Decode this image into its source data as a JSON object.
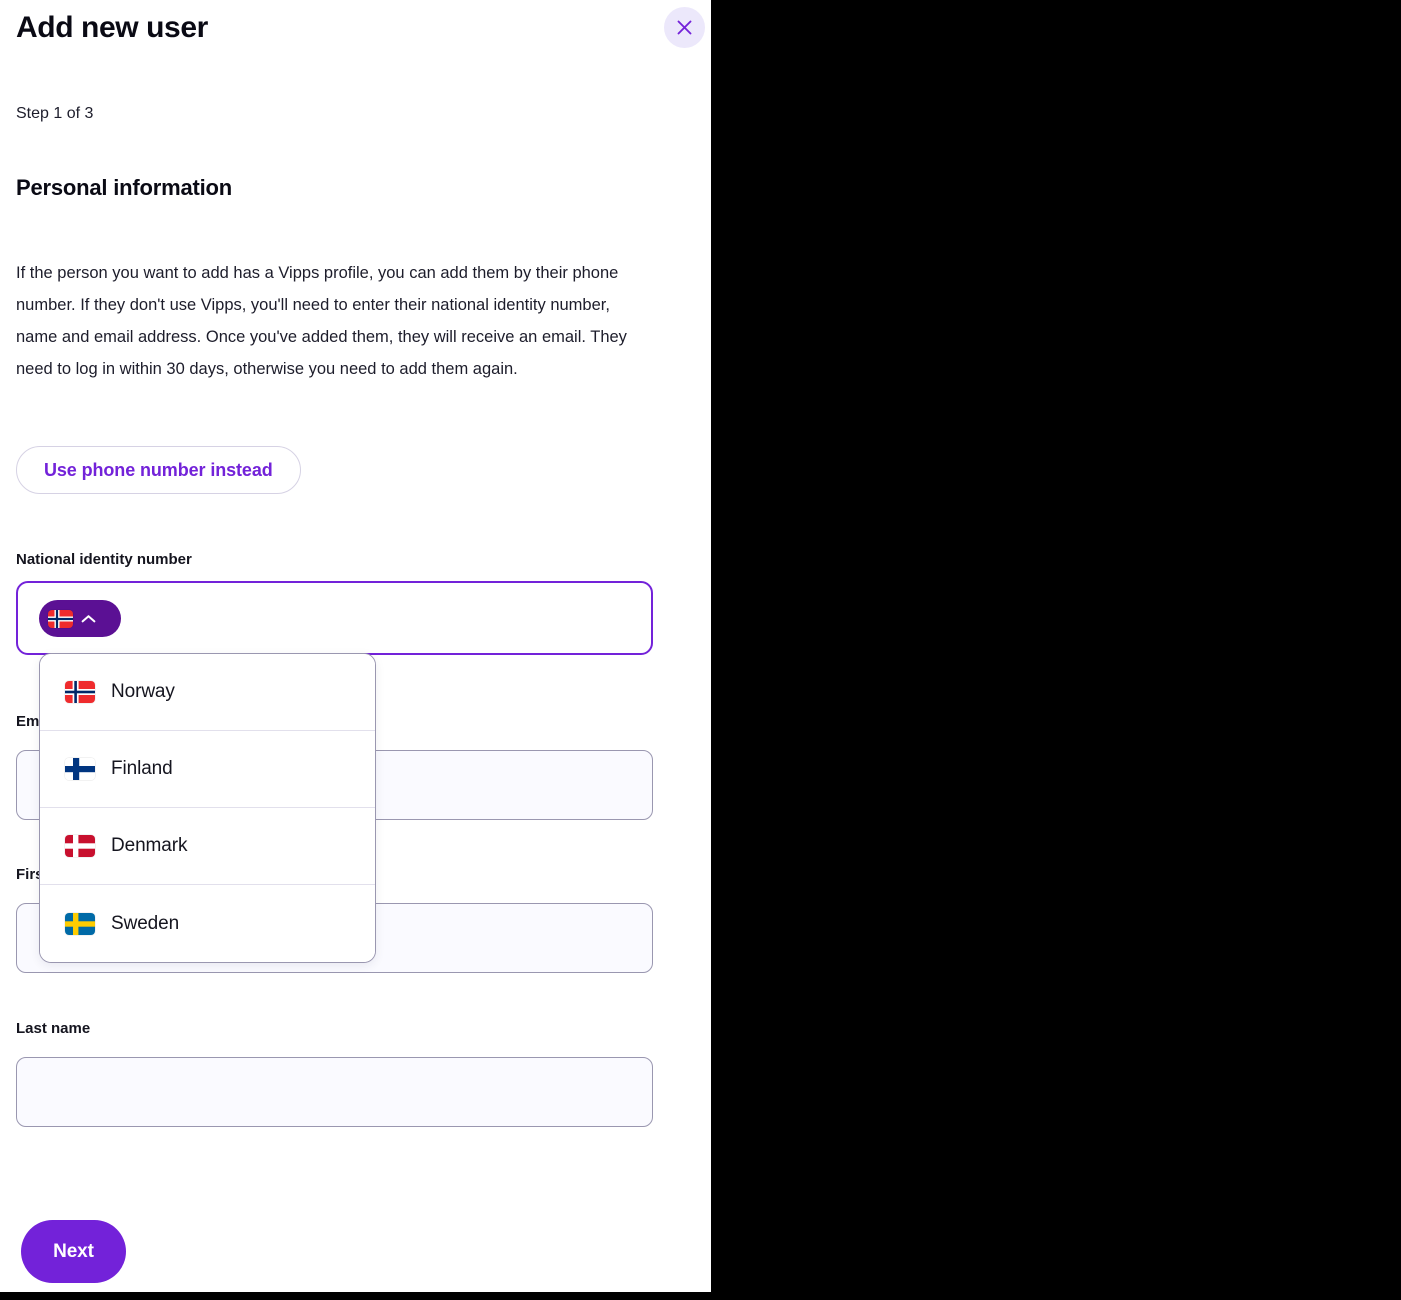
{
  "modal": {
    "title": "Add new user",
    "close_label": "×",
    "step": "Step 1 of 3",
    "section_title": "Personal information",
    "intro": "If the person you want to add has a Vipps profile, you can add them by their phone number. If they don't use Vipps, you'll need to enter their national identity number, name and email address. Once you've added them, they will receive an email. They need to log in within 30 days, otherwise you need to add them again.",
    "secondary_button": "Use phone number instead",
    "primary_button": "Next"
  },
  "form": {
    "national_identity": {
      "label": "National identity number",
      "value": "",
      "placeholder": ""
    },
    "email": {
      "label": "Email",
      "value": "",
      "placeholder": ""
    },
    "first_name": {
      "label": "First name",
      "value": "",
      "placeholder": ""
    },
    "last_name": {
      "label": "Last name",
      "value": "",
      "placeholder": ""
    }
  },
  "country_select": {
    "selected": "Norway",
    "selected_flag": "norway-flag-icon",
    "expanded": true,
    "chevron": "chevron-up-icon",
    "options": [
      {
        "label": "Norway",
        "flag": "norway-flag-icon"
      },
      {
        "label": "Finland",
        "flag": "finland-flag-icon"
      },
      {
        "label": "Denmark",
        "flag": "denmark-flag-icon"
      },
      {
        "label": "Sweden",
        "flag": "sweden-flag-icon"
      }
    ]
  },
  "colors": {
    "accent": "#7322d9",
    "accent_dark": "#5b1094",
    "close_bg": "#ece8fb",
    "input_bg": "#fafaff",
    "input_border": "#9a97b0",
    "text": "#15151f",
    "backdrop": "#000000"
  }
}
